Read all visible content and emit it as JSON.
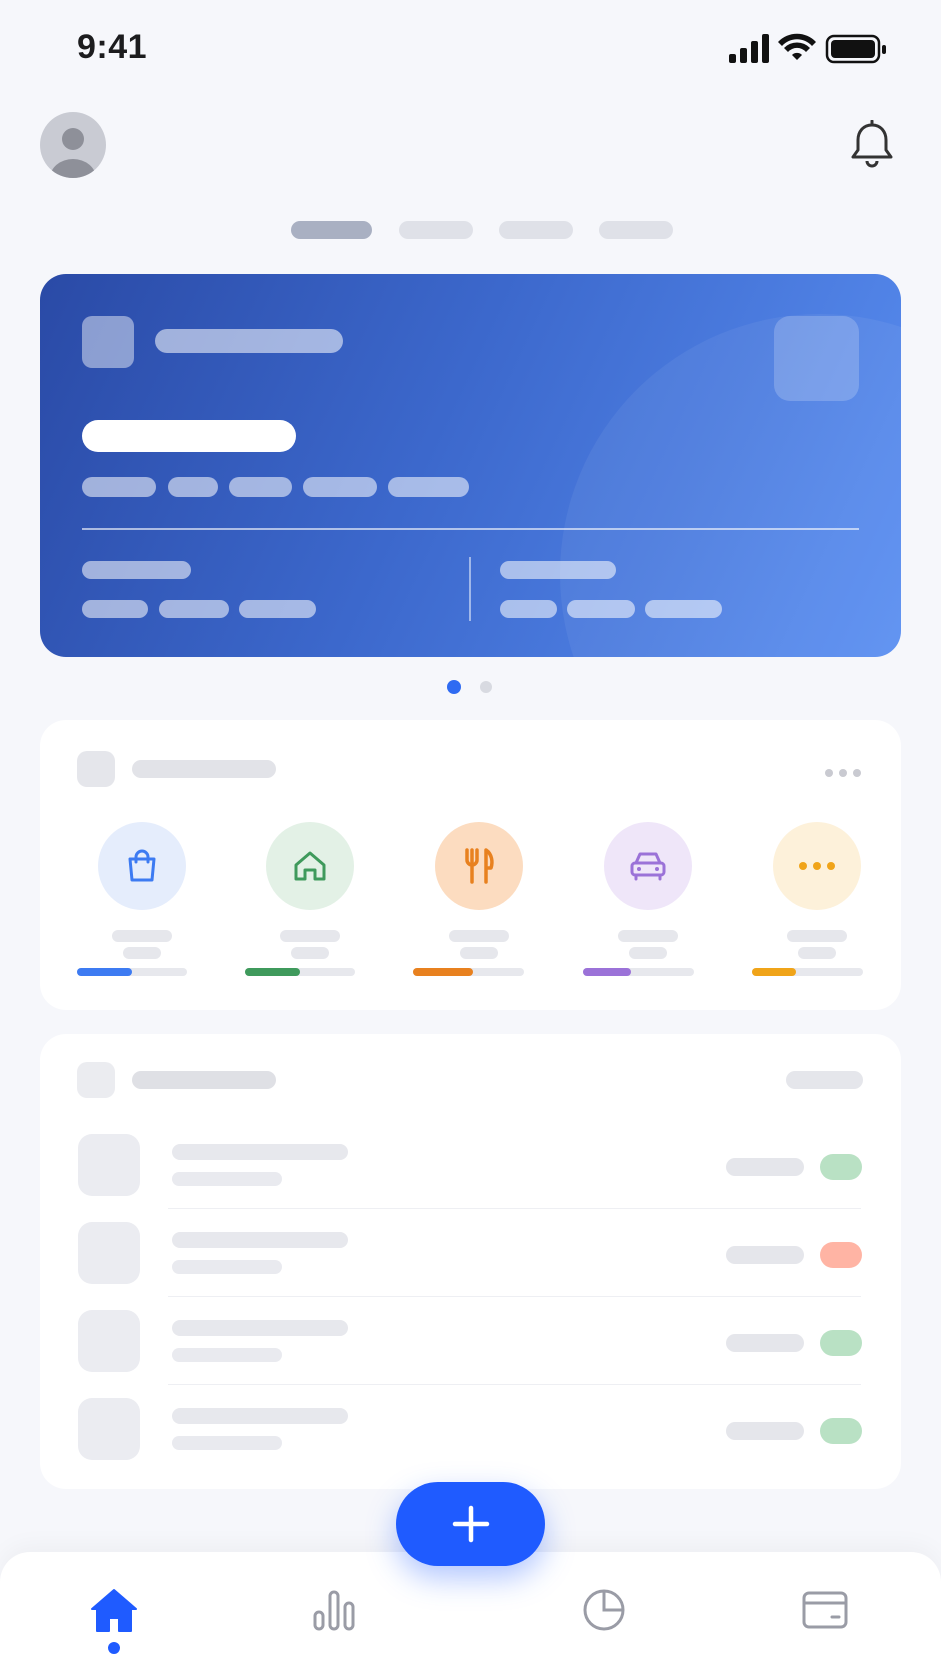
{
  "status_bar": {
    "time": "9:41"
  },
  "colors": {
    "accent": "#1f5bff",
    "hero_start": "#2a4aa6",
    "hero_end": "#5a8ff2",
    "skeleton": "#dfe1e8"
  },
  "header": {
    "avatar_icon": "person-icon",
    "notification_icon": "bell-icon"
  },
  "segments": {
    "active_index": 0,
    "count": 4
  },
  "hero_card": {
    "page_indicator_count": 2,
    "active_page": 0
  },
  "categories": {
    "more_icon": "ellipsis-icon",
    "items": [
      {
        "icon": "shopping-bag-icon",
        "color": "#3d7bf2",
        "bg": "#e5edfc",
        "progress": 0.5
      },
      {
        "icon": "home-icon",
        "color": "#3f9a5c",
        "bg": "#e3f1e6",
        "progress": 0.5
      },
      {
        "icon": "fork-knife-icon",
        "color": "#e8811f",
        "bg": "#fcdcc0",
        "progress": 0.54
      },
      {
        "icon": "car-icon",
        "color": "#9b72d8",
        "bg": "#efe6f9",
        "progress": 0.43
      },
      {
        "icon": "ellipsis-icon",
        "color": "#f0a419",
        "bg": "#fdf1da",
        "progress": 0.4
      }
    ]
  },
  "transactions": {
    "rows": [
      {
        "status_color": "#b9e1c4"
      },
      {
        "status_color": "#ffb4a4"
      },
      {
        "status_color": "#b9e1c4"
      },
      {
        "status_color": "#b9e1c4"
      }
    ]
  },
  "fab": {
    "icon": "plus-icon"
  },
  "tab_bar": {
    "active_index": 0,
    "items": [
      {
        "icon": "home-icon"
      },
      {
        "icon": "bar-chart-icon"
      },
      {
        "icon": "pie-chart-icon"
      },
      {
        "icon": "wallet-icon"
      }
    ]
  }
}
